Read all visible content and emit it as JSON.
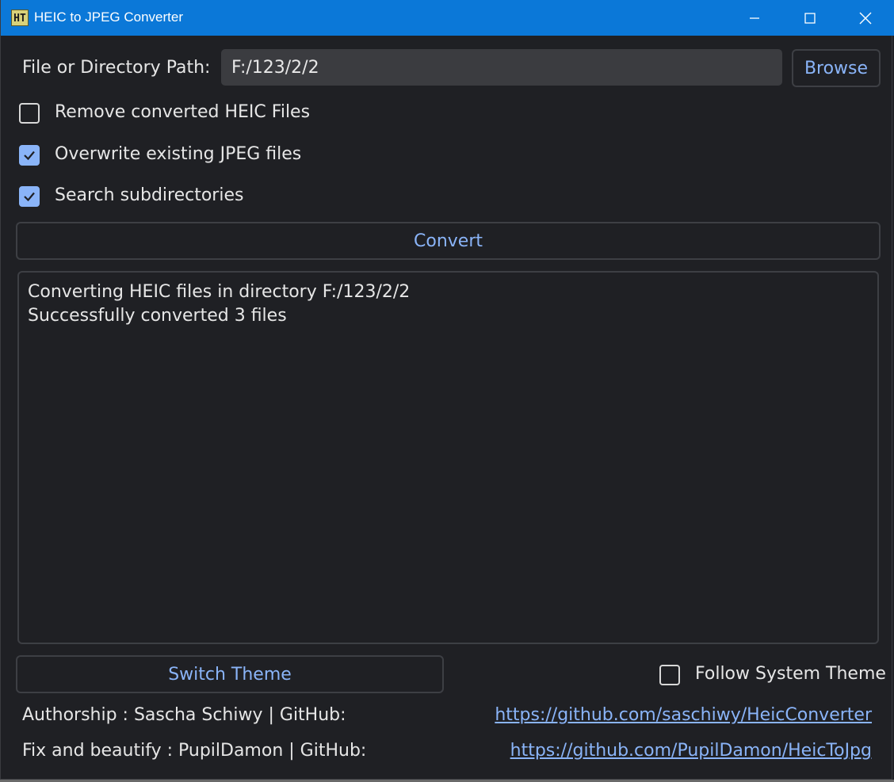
{
  "window": {
    "icon_text": "HT",
    "title": "HEIC to JPEG Converter"
  },
  "path_row": {
    "label": "File or Directory Path:",
    "value": "F:/123/2/2",
    "browse_label": "Browse"
  },
  "options": [
    {
      "label": "Remove converted HEIC Files",
      "checked": false
    },
    {
      "label": "Overwrite existing JPEG files",
      "checked": true
    },
    {
      "label": "Search subdirectories",
      "checked": true
    }
  ],
  "convert_label": "Convert",
  "log": {
    "lines": [
      "Converting HEIC files in directory F:/123/2/2",
      "Successfully converted 3 files"
    ]
  },
  "theme": {
    "switch_label": "Switch Theme",
    "follow_label": "Follow System Theme",
    "follow_checked": false
  },
  "credits": [
    {
      "text": "Authorship : Sascha Schiwy | GitHub:",
      "link": "https://github.com/saschiwy/HeicConverter"
    },
    {
      "text": "Fix and beautify : PupilDamon | GitHub:",
      "link": "https://github.com/PupilDamon/HeicToJpg"
    }
  ],
  "colors": {
    "titlebar": "#0b78d8",
    "background": "#1f2024",
    "accent": "#8ab4f8",
    "input_bg": "#3b3c40"
  }
}
